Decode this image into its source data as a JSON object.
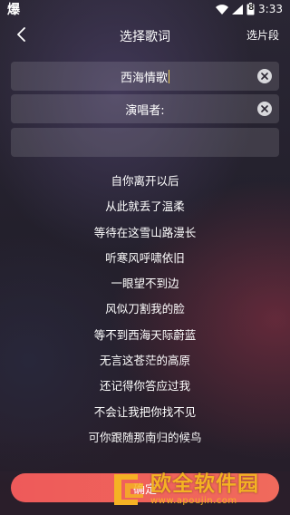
{
  "status_bar": {
    "app_glyph": "爆",
    "time": "3:33",
    "battery_level": "8"
  },
  "nav": {
    "title": "选择歌词",
    "segment_label": "选片段"
  },
  "inputs": {
    "song_value": "西海情歌",
    "singer_value": "演唱者:",
    "empty_value": ""
  },
  "lyrics": [
    "自你离开以后",
    "从此就丢了温柔",
    "等待在这雪山路漫长",
    "听寒风呼啸依旧",
    "一眼望不到边",
    "风似刀割我的脸",
    "等不到西海天际蔚蓝",
    "无言这苍茫的高原",
    "还记得你答应过我",
    "不会让我把你找不见",
    "可你跟随那南归的候鸟"
  ],
  "confirm_button": {
    "label": "确定"
  },
  "watermark": {
    "title": "欧全软件园",
    "url": "www.apoujin.com"
  },
  "colors": {
    "accent": "#ef5f5b",
    "watermark": "#f5b224",
    "cursor": "#f0d060"
  }
}
